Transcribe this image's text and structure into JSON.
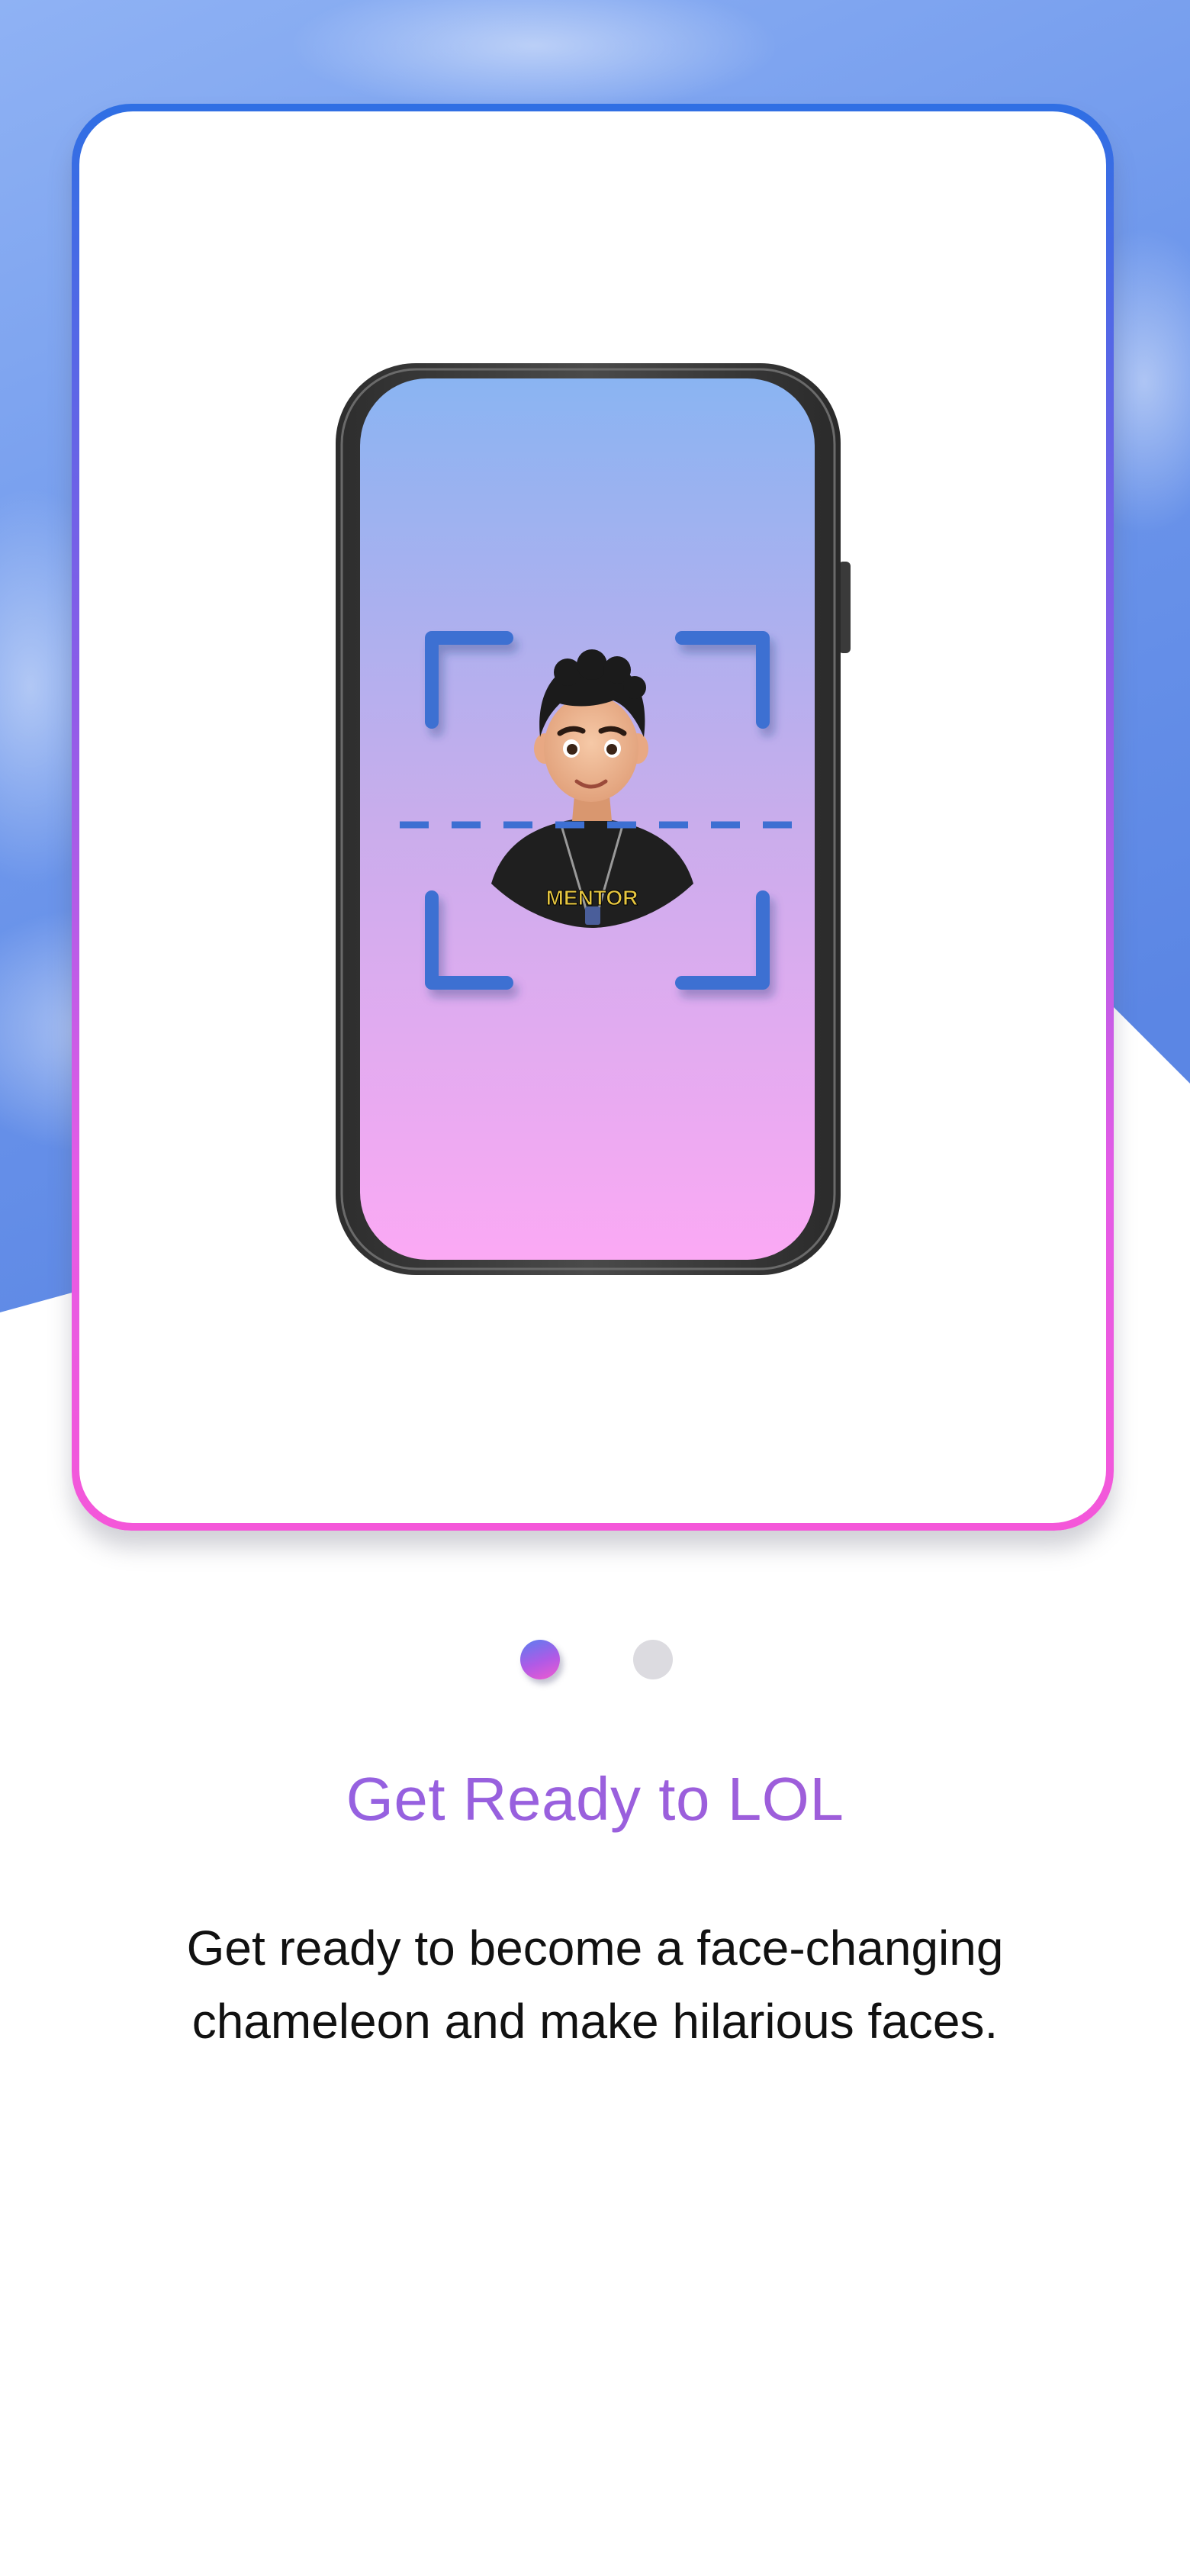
{
  "onboarding": {
    "illustration": {
      "device": "smartphone",
      "avatar_shirt_text": "MENTOR",
      "overlay": "face-scan-frame",
      "icon": "face-scan-icon"
    },
    "pagination": {
      "total": 2,
      "active_index": 0
    },
    "title": "Get Ready to LOL",
    "description": "Get ready to become a face-changing chameleon and make hilarious faces."
  },
  "colors": {
    "sky_top": "#86aaf2",
    "sky_bottom": "#5f8be8",
    "title": "#9b5fde",
    "card_border_top": "#2f6fe4",
    "card_border_bottom": "#f457d9",
    "screen_top": "#8ab4f2",
    "screen_bottom": "#fba9f4",
    "scan_frame": "#3d6fd2",
    "dot_inactive": "#dcdbe0"
  }
}
